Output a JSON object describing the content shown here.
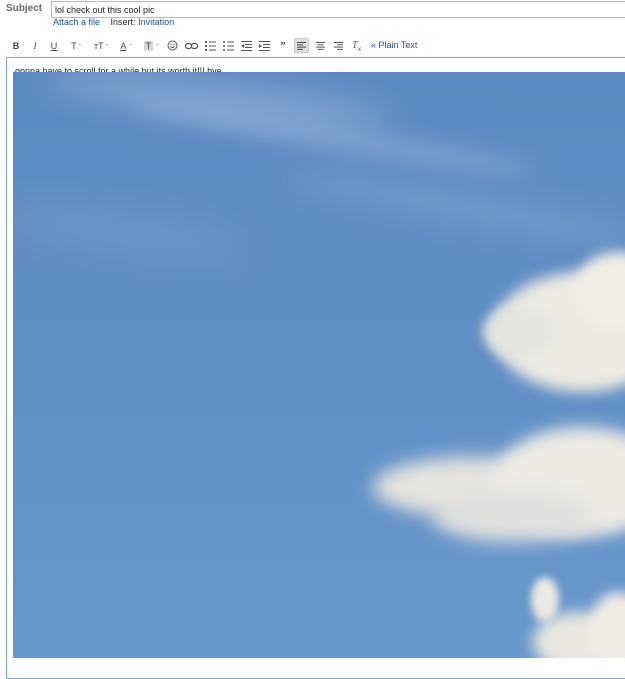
{
  "subject": {
    "label": "Subject",
    "value": "lol check out this cool pic"
  },
  "attach": {
    "attach_label": "Attach a file",
    "insert_label": "Insert:",
    "invitation_label": "Invitation"
  },
  "toolbar": {
    "bold": "B",
    "italic": "I",
    "underline": "U",
    "font": "T",
    "font_size": "тT",
    "text_color": "A",
    "highlight": "T",
    "plain_text_label": "« Plain Text"
  },
  "message": {
    "body_text": "gonna have to scroll for a while but its worth it!!! bye"
  },
  "colors": {
    "link": "#1c4fa8",
    "sky": "#5f8cc3",
    "cloud": "#f1ede4",
    "editor_border": "#7aa3d6"
  }
}
